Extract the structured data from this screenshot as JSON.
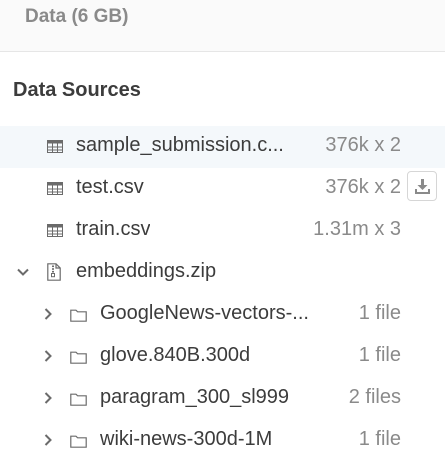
{
  "header": {
    "title": "Data (6 GB)"
  },
  "section": {
    "title": "Data Sources"
  },
  "files": [
    {
      "name": "sample_submission.c...",
      "size": "376k x 2",
      "icon": "table-icon"
    },
    {
      "name": "test.csv",
      "size": "376k x 2",
      "icon": "table-icon"
    },
    {
      "name": "train.csv",
      "size": "1.31m x 3",
      "icon": "table-icon"
    }
  ],
  "archive": {
    "name": "embeddings.zip",
    "icon": "zip-file-icon",
    "expanded": true
  },
  "folders": [
    {
      "name": "GoogleNews-vectors-...",
      "count": "1 file",
      "icon": "folder-icon"
    },
    {
      "name": "glove.840B.300d",
      "count": "1 file",
      "icon": "folder-icon"
    },
    {
      "name": "paragram_300_sl999",
      "count": "2 files",
      "icon": "folder-icon"
    },
    {
      "name": "wiki-news-300d-1M",
      "count": "1 file",
      "icon": "folder-icon"
    }
  ],
  "colors": {
    "text": "#3c3c3c",
    "muted": "#8a8a8a",
    "selected_bg": "#f4f8fb",
    "header_bg": "#fafafa"
  }
}
